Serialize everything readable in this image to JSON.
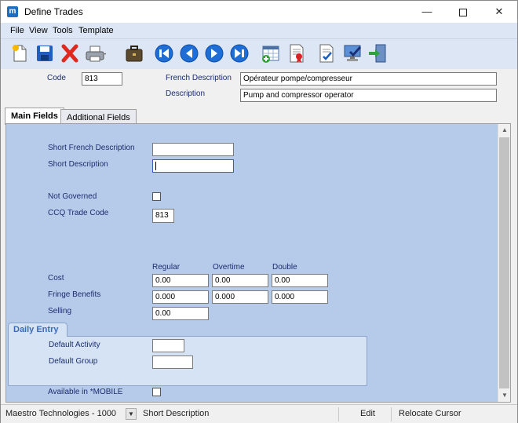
{
  "window": {
    "title": "Define Trades",
    "minimize_glyph": "—",
    "close_glyph": "✕",
    "app_icon_letter": "m"
  },
  "menu": [
    "File",
    "View",
    "Tools",
    "Template"
  ],
  "toolbar": {
    "icons": [
      "new-document-icon",
      "save-icon",
      "delete-icon",
      "print-icon",
      "briefcase-icon",
      "first-record-icon",
      "previous-record-icon",
      "next-record-icon",
      "last-record-icon",
      "add-grid-icon",
      "report-icon",
      "edit-document-icon",
      "monitor-check-icon",
      "exit-icon"
    ]
  },
  "header": {
    "code_label": "Code",
    "code_value": "813",
    "french_description_label": "French Description",
    "french_description_value": "Opérateur pompe/compresseur",
    "description_label": "Description",
    "description_value": "Pump and compressor operator"
  },
  "tabs": [
    {
      "label": "Main Fields",
      "active": true
    },
    {
      "label": "Additional Fields",
      "active": false
    }
  ],
  "main": {
    "short_french_description_label": "Short French Description",
    "short_french_description_value": "",
    "short_description_label": "Short Description",
    "short_description_value": "",
    "not_governed_label": "Not Governed",
    "not_governed_checked": false,
    "ccq_trade_code_label": "CCQ Trade Code",
    "ccq_trade_code_value": "813",
    "columns": [
      "Regular",
      "Overtime",
      "Double"
    ],
    "cost_label": "Cost",
    "cost_values": [
      "0.00",
      "0.00",
      "0.00"
    ],
    "fringe_benefits_label": "Fringe Benefits",
    "fringe_values": [
      "0.000",
      "0.000",
      "0.000"
    ],
    "selling_label": "Selling",
    "selling_value": "0.00",
    "daily_entry": {
      "title": "Daily Entry",
      "default_activity_label": "Default Activity",
      "default_activity_value": "",
      "default_group_label": "Default Group",
      "default_group_value": ""
    },
    "available_mobile_label": "Available in *MOBILE",
    "available_mobile_checked": false
  },
  "status": {
    "company": "Maestro Technologies - 1000",
    "field": "Short Description",
    "mode": "Edit",
    "hint": "Relocate Cursor"
  },
  "colors": {
    "panel_background": "#b6cbea",
    "label_text": "#1a2d6e",
    "group_title": "#3a6bb8",
    "toolbar_background": "#dde6f4"
  }
}
